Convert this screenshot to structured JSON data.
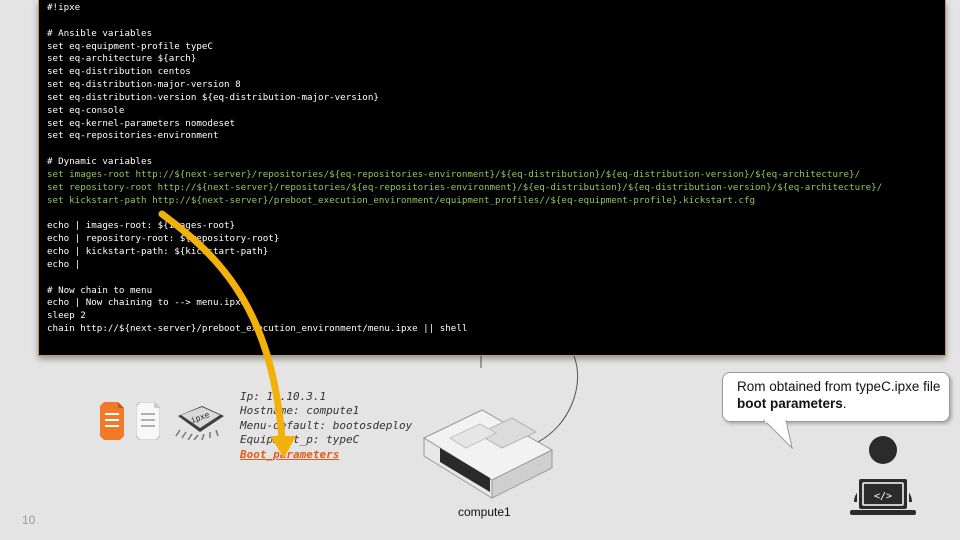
{
  "terminal": {
    "lines": [
      {
        "text": "#!ipxe",
        "color": "white"
      },
      {
        "text": "",
        "color": "white"
      },
      {
        "text": "# Ansible variables",
        "color": "white"
      },
      {
        "text": "set eq-equipment-profile typeC",
        "color": "white"
      },
      {
        "text": "set eq-architecture ${arch}",
        "color": "white"
      },
      {
        "text": "set eq-distribution centos",
        "color": "white"
      },
      {
        "text": "set eq-distribution-major-version 8",
        "color": "white"
      },
      {
        "text": "set eq-distribution-version ${eq-distribution-major-version}",
        "color": "white"
      },
      {
        "text": "set eq-console",
        "color": "white"
      },
      {
        "text": "set eq-kernel-parameters nomodeset",
        "color": "white"
      },
      {
        "text": "set eq-repositories-environment",
        "color": "white"
      },
      {
        "text": "",
        "color": "white"
      },
      {
        "text": "# Dynamic variables",
        "color": "white"
      },
      {
        "text": "set images-root http://${next-server}/repositories/${eq-repositories-environment}/${eq-distribution}/${eq-distribution-version}/${eq-architecture}/",
        "color": "green"
      },
      {
        "text": "set repository-root http://${next-server}/repositories/${eq-repositories-environment}/${eq-distribution}/${eq-distribution-version}/${eq-architecture}/",
        "color": "green"
      },
      {
        "text": "set kickstart-path http://${next-server}/preboot_execution_environment/equipment_profiles//${eq-equipment-profile}.kickstart.cfg",
        "color": "green"
      },
      {
        "text": "",
        "color": "white"
      },
      {
        "text": "echo | images-root: ${images-root}",
        "color": "white"
      },
      {
        "text": "echo | repository-root: ${repository-root}",
        "color": "white"
      },
      {
        "text": "echo | kickstart-path: ${kickstart-path}",
        "color": "white"
      },
      {
        "text": "echo |",
        "color": "white"
      },
      {
        "text": "",
        "color": "white"
      },
      {
        "text": "# Now chain to menu",
        "color": "white"
      },
      {
        "text": "echo | Now chaining to --> menu.ipxe",
        "color": "white"
      },
      {
        "text": "sleep 2",
        "color": "white"
      },
      {
        "text": "chain http://${next-server}/preboot_execution_environment/menu.ipxe || shell",
        "color": "white"
      }
    ]
  },
  "info": {
    "ip": "Ip: 10.10.3.1",
    "hostname": "Hostname: compute1",
    "menu_default": "Menu-default: bootosdeploy",
    "equipment": "Equipment_p: typeC",
    "boot_parameters": "Boot_parameters"
  },
  "chip_label": "ipxe",
  "server_label": "compute1",
  "callout": {
    "text_part1": "Rom obtained from typeC.ipxe file ",
    "text_bold": "boot parameters",
    "text_end": "."
  },
  "slide_number": "10",
  "colors": {
    "arrow": "#f2b10a",
    "boot_parameters": "#e35a1a",
    "terminal_green": "#8ec660",
    "terminal_border": "#c89a3c"
  },
  "icons": [
    "orange-file-icon",
    "white-file-icon",
    "ipxe-chip-icon",
    "server-icon",
    "developer-laptop-icon"
  ]
}
